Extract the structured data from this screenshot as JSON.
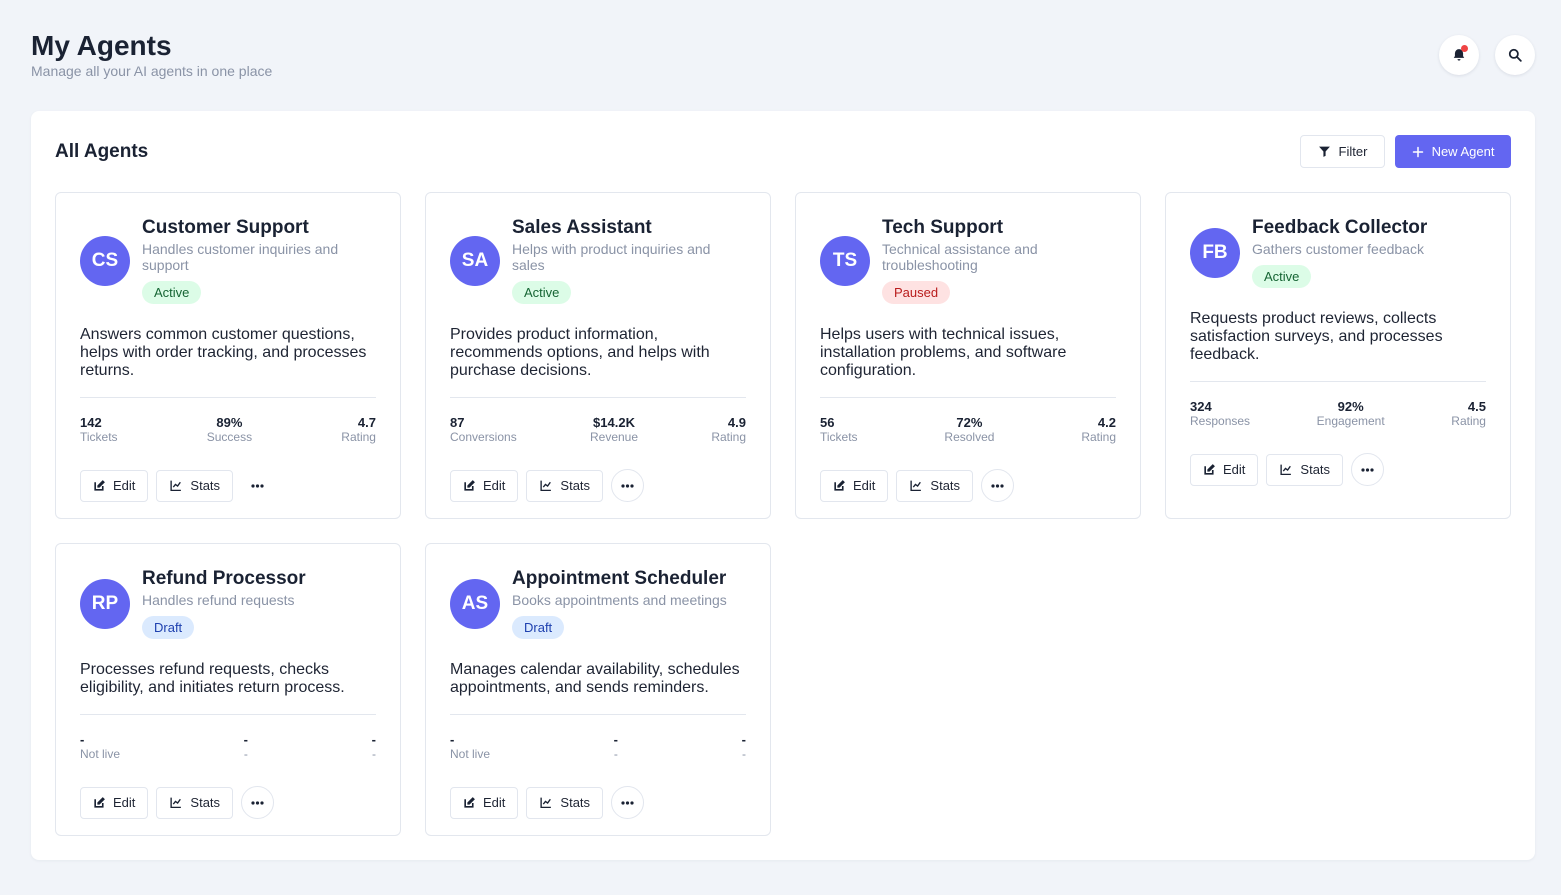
{
  "header": {
    "title": "My Agents",
    "subtitle": "Manage all your AI agents in one place",
    "icons": [
      "bell-icon",
      "search-icon"
    ]
  },
  "panel": {
    "title": "All Agents",
    "filter_label": "Filter",
    "new_agent_label": "New Agent"
  },
  "colors": {
    "accent": "#6366f1",
    "active_bg": "#dcfce7",
    "paused_bg": "#fee2e2",
    "draft_bg": "#dbeafe"
  },
  "agents": [
    {
      "initials": "CS",
      "name": "Customer Support",
      "tagline": "Handles customer inquiries and support",
      "status": "Active",
      "description": "Answers common customer questions, helps with order tracking, and processes returns.",
      "stats": [
        {
          "value": "142",
          "label": "Tickets"
        },
        {
          "value": "89%",
          "label": "Success"
        },
        {
          "value": "4.7",
          "label": "Rating"
        }
      ],
      "edit_label": "Edit",
      "stats_label": "Stats"
    },
    {
      "initials": "SA",
      "name": "Sales Assistant",
      "tagline": "Helps with product inquiries and sales",
      "status": "Active",
      "description": "Provides product information, recommends options, and helps with purchase decisions.",
      "stats": [
        {
          "value": "87",
          "label": "Conversions"
        },
        {
          "value": "$14.2K",
          "label": "Revenue"
        },
        {
          "value": "4.9",
          "label": "Rating"
        }
      ],
      "edit_label": "Edit",
      "stats_label": "Stats"
    },
    {
      "initials": "TS",
      "name": "Tech Support",
      "tagline": "Technical assistance and troubleshooting",
      "status": "Paused",
      "description": "Helps users with technical issues, installation problems, and software configuration.",
      "stats": [
        {
          "value": "56",
          "label": "Tickets"
        },
        {
          "value": "72%",
          "label": "Resolved"
        },
        {
          "value": "4.2",
          "label": "Rating"
        }
      ],
      "edit_label": "Edit",
      "stats_label": "Stats"
    },
    {
      "initials": "FB",
      "name": "Feedback Collector",
      "tagline": "Gathers customer feedback",
      "status": "Active",
      "description": "Requests product reviews, collects satisfaction surveys, and processes feedback.",
      "stats": [
        {
          "value": "324",
          "label": "Responses"
        },
        {
          "value": "92%",
          "label": "Engagement"
        },
        {
          "value": "4.5",
          "label": "Rating"
        }
      ],
      "edit_label": "Edit",
      "stats_label": "Stats"
    },
    {
      "initials": "RP",
      "name": "Refund Processor",
      "tagline": "Handles refund requests",
      "status": "Draft",
      "description": "Processes refund requests, checks eligibility, and initiates return process.",
      "stats": [
        {
          "value": "-",
          "label": "Not live"
        },
        {
          "value": "-",
          "label": "-"
        },
        {
          "value": "-",
          "label": "-"
        }
      ],
      "edit_label": "Edit",
      "stats_label": "Stats"
    },
    {
      "initials": "AS",
      "name": "Appointment Scheduler",
      "tagline": "Books appointments and meetings",
      "status": "Draft",
      "description": "Manages calendar availability, schedules appointments, and sends reminders.",
      "stats": [
        {
          "value": "-",
          "label": "Not live"
        },
        {
          "value": "-",
          "label": "-"
        },
        {
          "value": "-",
          "label": "-"
        }
      ],
      "edit_label": "Edit",
      "stats_label": "Stats"
    }
  ]
}
